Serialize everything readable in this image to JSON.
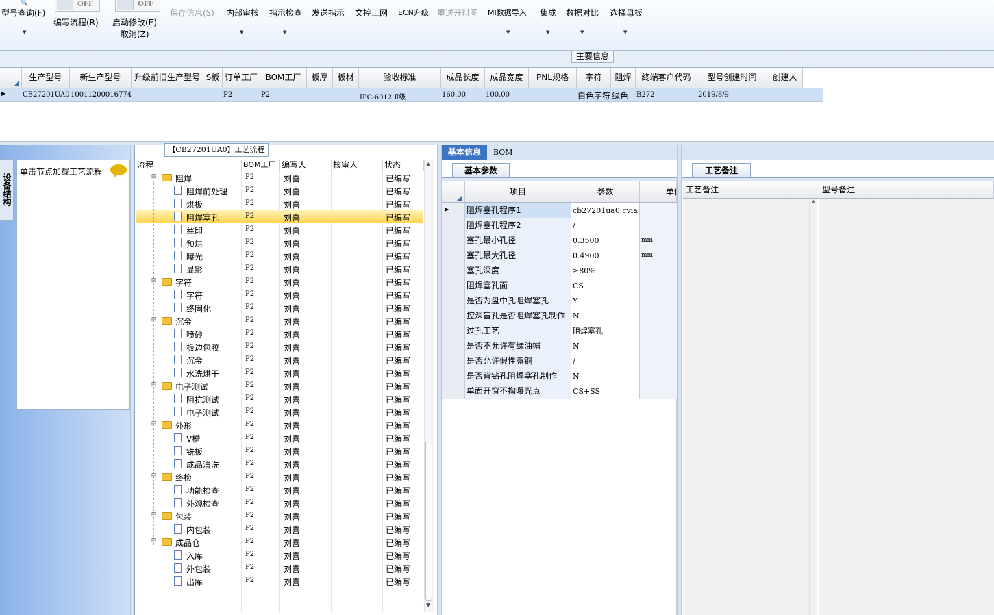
{
  "toolbar": {
    "query_label": "型号查询(F)",
    "toggle_off": "OFF",
    "write_flow_label": "编写流程(R)",
    "start_modify_label": "启动修改(E)",
    "cancel_label": "取消(Z)",
    "save_label": "保存信息(S)",
    "internal_review_label": "内部审核",
    "instruction_check_label": "指示检查",
    "send_instruction_label": "发送指示",
    "wenkong_label": "文控上网",
    "ecn_label": "ECN升级",
    "reopen_label": "重送开料图",
    "mi_import_label": "MI数据导入",
    "integrate_label": "集成",
    "compare_label": "数据对比",
    "select_master_label": "选择母板"
  },
  "main_info": {
    "section_label": "主要信息",
    "columns": [
      "生产型号",
      "新生产型号",
      "升级前旧生产型号",
      "S板",
      "订单工厂",
      "BOM工厂",
      "板厚",
      "板材",
      "验收标准",
      "成品长度",
      "成品宽度",
      "PNL规格",
      "字符",
      "阻焊",
      "终端客户代码",
      "型号创建时间",
      "创建人"
    ],
    "row": [
      "CB27201UA0",
      "10011200016774",
      "",
      "",
      "P2",
      "P2",
      "",
      "",
      "IPC-6012 Ⅱ级",
      "160.00",
      "100.00",
      "",
      "白色字符",
      "绿色",
      "B272",
      "2019/8/9",
      ""
    ]
  },
  "left": {
    "vertical_tab": "设备结构",
    "load_hint": "单击节点加载工艺流程"
  },
  "tree": {
    "title": "【CB27201UA0】工艺流程",
    "headers": [
      "流程",
      "BOM工厂",
      "编写人",
      "核审人",
      "状态"
    ],
    "rows": [
      {
        "name": "阻焊",
        "level": 0,
        "bom": "P2",
        "writer": "刘喜",
        "status": "已编写"
      },
      {
        "name": "阻焊前处理",
        "level": 1,
        "bom": "P2",
        "writer": "刘喜",
        "status": "已编写"
      },
      {
        "name": "烘板",
        "level": 1,
        "bom": "P2",
        "writer": "刘喜",
        "status": "已编写"
      },
      {
        "name": "阻焊塞孔",
        "level": 1,
        "bom": "P2",
        "writer": "刘喜",
        "status": "已编写",
        "selected": true
      },
      {
        "name": "丝印",
        "level": 1,
        "bom": "P2",
        "writer": "刘喜",
        "status": "已编写"
      },
      {
        "name": "预烘",
        "level": 1,
        "bom": "P2",
        "writer": "刘喜",
        "status": "已编写"
      },
      {
        "name": "曝光",
        "level": 1,
        "bom": "P2",
        "writer": "刘喜",
        "status": "已编写"
      },
      {
        "name": "显影",
        "level": 1,
        "bom": "P2",
        "writer": "刘喜",
        "status": "已编写"
      },
      {
        "name": "字符",
        "level": 0,
        "bom": "P2",
        "writer": "刘喜",
        "status": "已编写"
      },
      {
        "name": "字符",
        "level": 1,
        "bom": "P2",
        "writer": "刘喜",
        "status": "已编写"
      },
      {
        "name": "终固化",
        "level": 1,
        "bom": "P2",
        "writer": "刘喜",
        "status": "已编写"
      },
      {
        "name": "沉金",
        "level": 0,
        "bom": "P2",
        "writer": "刘喜",
        "status": "已编写"
      },
      {
        "name": "喷砂",
        "level": 1,
        "bom": "P2",
        "writer": "刘喜",
        "status": "已编写"
      },
      {
        "name": "板边包胶",
        "level": 1,
        "bom": "P2",
        "writer": "刘喜",
        "status": "已编写"
      },
      {
        "name": "沉金",
        "level": 1,
        "bom": "P2",
        "writer": "刘喜",
        "status": "已编写"
      },
      {
        "name": "水洗烘干",
        "level": 1,
        "bom": "P2",
        "writer": "刘喜",
        "status": "已编写"
      },
      {
        "name": "电子测试",
        "level": 0,
        "bom": "P2",
        "writer": "刘喜",
        "status": "已编写"
      },
      {
        "name": "阻抗测试",
        "level": 1,
        "bom": "P2",
        "writer": "刘喜",
        "status": "已编写"
      },
      {
        "name": "电子测试",
        "level": 1,
        "bom": "P2",
        "writer": "刘喜",
        "status": "已编写"
      },
      {
        "name": "外形",
        "level": 0,
        "bom": "P2",
        "writer": "刘喜",
        "status": "已编写"
      },
      {
        "name": "V槽",
        "level": 1,
        "bom": "P2",
        "writer": "刘喜",
        "status": "已编写"
      },
      {
        "name": "铣板",
        "level": 1,
        "bom": "P2",
        "writer": "刘喜",
        "status": "已编写"
      },
      {
        "name": "成品清洗",
        "level": 1,
        "bom": "P2",
        "writer": "刘喜",
        "status": "已编写"
      },
      {
        "name": "终检",
        "level": 0,
        "bom": "P2",
        "writer": "刘喜",
        "status": "已编写"
      },
      {
        "name": "功能检查",
        "level": 1,
        "bom": "P2",
        "writer": "刘喜",
        "status": "已编写"
      },
      {
        "name": "外观检查",
        "level": 1,
        "bom": "P2",
        "writer": "刘喜",
        "status": "已编写"
      },
      {
        "name": "包装",
        "level": 0,
        "bom": "P2",
        "writer": "刘喜",
        "status": "已编写"
      },
      {
        "name": "内包装",
        "level": 1,
        "bom": "P2",
        "writer": "刘喜",
        "status": "已编写"
      },
      {
        "name": "成品仓",
        "level": 0,
        "bom": "P2",
        "writer": "刘喜",
        "status": "已编写"
      },
      {
        "name": "入库",
        "level": 1,
        "bom": "P2",
        "writer": "刘喜",
        "status": "已编写"
      },
      {
        "name": "外包装",
        "level": 1,
        "bom": "P2",
        "writer": "刘喜",
        "status": "已编写"
      },
      {
        "name": "出库",
        "level": 1,
        "bom": "P2",
        "writer": "刘喜",
        "status": "已编写"
      }
    ]
  },
  "params": {
    "tab_basic": "基本信息",
    "tab_bom": "BOM",
    "subtab": "基本参数",
    "headers": [
      "项目",
      "参数",
      "单位"
    ],
    "rows": [
      {
        "item": "阻焊塞孔程序1",
        "value": "cb27201ua0.cvia",
        "unit": ""
      },
      {
        "item": "阻焊塞孔程序2",
        "value": "/",
        "unit": ""
      },
      {
        "item": "塞孔最小孔径",
        "value": "0.3500",
        "unit": "mm"
      },
      {
        "item": "塞孔最大孔径",
        "value": "0.4900",
        "unit": "mm"
      },
      {
        "item": "塞孔深度",
        "value": "≥80%",
        "unit": ""
      },
      {
        "item": "阻焊塞孔面",
        "value": "CS",
        "unit": ""
      },
      {
        "item": "是否为盘中孔阻焊塞孔",
        "value": "Y",
        "unit": ""
      },
      {
        "item": "控深盲孔是否阻焊塞孔制作",
        "value": "N",
        "unit": ""
      },
      {
        "item": "过孔工艺",
        "value": "阻焊塞孔",
        "unit": ""
      },
      {
        "item": "是否不允许有绿油帽",
        "value": "N",
        "unit": ""
      },
      {
        "item": "是否允许假性露铜",
        "value": "/",
        "unit": ""
      },
      {
        "item": "是否背钻孔阻焊塞孔制作",
        "value": "N",
        "unit": ""
      },
      {
        "item": "单面开窗不掏曝光点",
        "value": "CS+SS",
        "unit": ""
      }
    ]
  },
  "memo": {
    "subtab": "工艺备注",
    "col_process": "工艺备注",
    "col_model": "型号备注"
  }
}
